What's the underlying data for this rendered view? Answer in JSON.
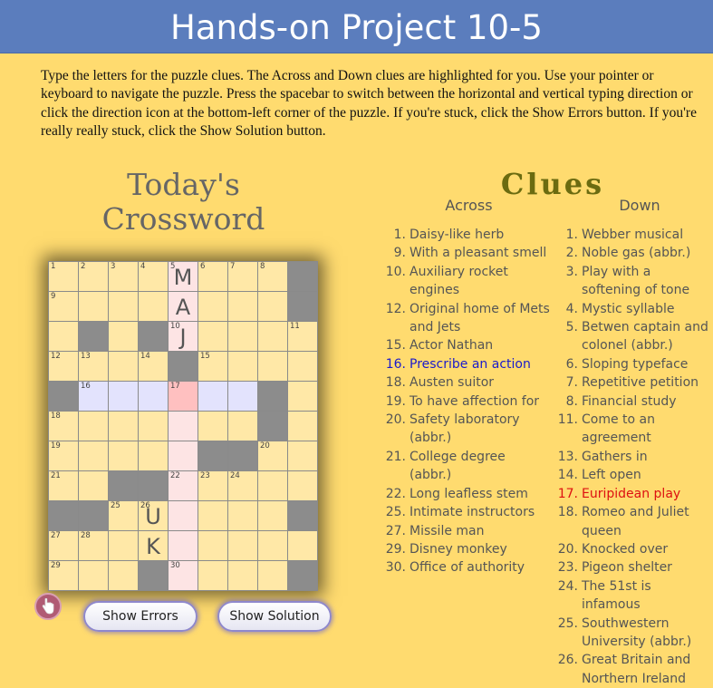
{
  "page_title": "Hands-on Project 10-5",
  "intro": "Type the letters for the puzzle clues. The Across and Down clues are highlighted for you. Use your pointer or keyboard to navigate the puzzle. Press the spacebar to switch between the horizontal and vertical typing direction or click the direction icon at the bottom-left corner of the puzzle. If you're stuck, click the Show Errors button. If you're really really stuck, click the Show Solution button.",
  "puzzle_title": "Today's Crossword",
  "buttons": {
    "show_errors": "Show Errors",
    "show_solution": "Show Solution"
  },
  "direction_icon": "pointing-hand-down-icon",
  "clues_title": "Clues",
  "across_heading": "Across",
  "down_heading": "Down",
  "highlight_colors": {
    "across": "#1a1acc",
    "down": "#dd1111",
    "active_cell": "#ffc0c0"
  },
  "grid": {
    "rows": [
      [
        {
          "n": "1"
        },
        {
          "n": "2"
        },
        {
          "n": "3"
        },
        {
          "n": "4"
        },
        {
          "n": "5",
          "l": "M",
          "s": "down"
        },
        {
          "n": "6"
        },
        {
          "n": "7"
        },
        {
          "n": "8"
        },
        {
          "b": true
        }
      ],
      [
        {
          "n": "9"
        },
        {},
        {},
        {},
        {
          "l": "A",
          "s": "down"
        },
        {},
        {},
        {},
        {
          "b": true
        }
      ],
      [
        {},
        {
          "b": true
        },
        {},
        {
          "b": true
        },
        {
          "n": "10",
          "l": "J",
          "s": "down"
        },
        {},
        {},
        {},
        {
          "n": "11"
        }
      ],
      [
        {
          "n": "12"
        },
        {
          "n": "13"
        },
        {},
        {
          "n": "14"
        },
        {
          "b": true
        },
        {
          "n": "15"
        },
        {},
        {},
        {}
      ],
      [
        {
          "b": true
        },
        {
          "n": "16",
          "s": "across"
        },
        {
          "s": "across"
        },
        {
          "s": "across"
        },
        {
          "n": "17",
          "s": "active"
        },
        {
          "s": "across"
        },
        {
          "s": "across"
        },
        {
          "b": true
        },
        {}
      ],
      [
        {
          "n": "18"
        },
        {},
        {},
        {},
        {
          "s": "down"
        },
        {},
        {},
        {
          "b": true
        },
        {}
      ],
      [
        {
          "n": "19"
        },
        {},
        {},
        {},
        {
          "s": "down"
        },
        {
          "b": true
        },
        {
          "b": true
        },
        {
          "n": "20"
        },
        {}
      ],
      [
        {
          "n": "21"
        },
        {},
        {
          "b": true
        },
        {
          "b": true
        },
        {
          "n": "22",
          "s": "down"
        },
        {
          "n": "23"
        },
        {
          "n": "24"
        },
        {},
        {}
      ],
      [
        {
          "b": true
        },
        {
          "b": true
        },
        {
          "n": "25"
        },
        {
          "n": "26",
          "l": "U"
        },
        {
          "s": "down"
        },
        {},
        {},
        {},
        {
          "b": true
        }
      ],
      [
        {
          "n": "27"
        },
        {
          "n": "28"
        },
        {},
        {
          "l": "K"
        },
        {
          "s": "down"
        },
        {},
        {},
        {},
        {}
      ],
      [
        {
          "n": "29"
        },
        {},
        {},
        {
          "b": true
        },
        {
          "n": "30",
          "s": "down"
        },
        {},
        {},
        {},
        {
          "b": true
        }
      ]
    ]
  },
  "across_clues": [
    {
      "n": "1.",
      "t": "Daisy-like herb"
    },
    {
      "n": "9.",
      "t": "With a pleasant smell"
    },
    {
      "n": "10.",
      "t": "Auxiliary rocket engines"
    },
    {
      "n": "12.",
      "t": "Original home of Mets and Jets"
    },
    {
      "n": "15.",
      "t": "Actor Nathan"
    },
    {
      "n": "16.",
      "t": "Prescribe an action",
      "hl": true
    },
    {
      "n": "18.",
      "t": "Austen suitor"
    },
    {
      "n": "19.",
      "t": "To have affection for"
    },
    {
      "n": "20.",
      "t": "Safety laboratory (abbr.)"
    },
    {
      "n": "21.",
      "t": "College degree (abbr.)"
    },
    {
      "n": "22.",
      "t": "Long leafless stem"
    },
    {
      "n": "25.",
      "t": "Intimate instructors"
    },
    {
      "n": "27.",
      "t": "Missile man"
    },
    {
      "n": "29.",
      "t": "Disney monkey"
    },
    {
      "n": "30.",
      "t": "Office of authority"
    }
  ],
  "down_clues": [
    {
      "n": "1.",
      "t": "Webber musical"
    },
    {
      "n": "2.",
      "t": "Noble gas (abbr.)"
    },
    {
      "n": "3.",
      "t": "Play with a softening of tone"
    },
    {
      "n": "4.",
      "t": "Mystic syllable"
    },
    {
      "n": "5.",
      "t": "Betwen captain and colonel (abbr.)"
    },
    {
      "n": "6.",
      "t": "Sloping typeface"
    },
    {
      "n": "7.",
      "t": "Repetitive petition"
    },
    {
      "n": "8.",
      "t": "Financial study"
    },
    {
      "n": "11.",
      "t": "Come to an agreement"
    },
    {
      "n": "13.",
      "t": "Gathers in"
    },
    {
      "n": "14.",
      "t": "Left open"
    },
    {
      "n": "17.",
      "t": "Euripidean play",
      "hl": true
    },
    {
      "n": "18.",
      "t": "Romeo and Juliet queen"
    },
    {
      "n": "20.",
      "t": "Knocked over"
    },
    {
      "n": "23.",
      "t": "Pigeon shelter"
    },
    {
      "n": "24.",
      "t": "The 51st is infamous"
    },
    {
      "n": "25.",
      "t": "Southwestern University (abbr.)"
    },
    {
      "n": "26.",
      "t": "Great Britain and Northern Ireland"
    }
  ]
}
